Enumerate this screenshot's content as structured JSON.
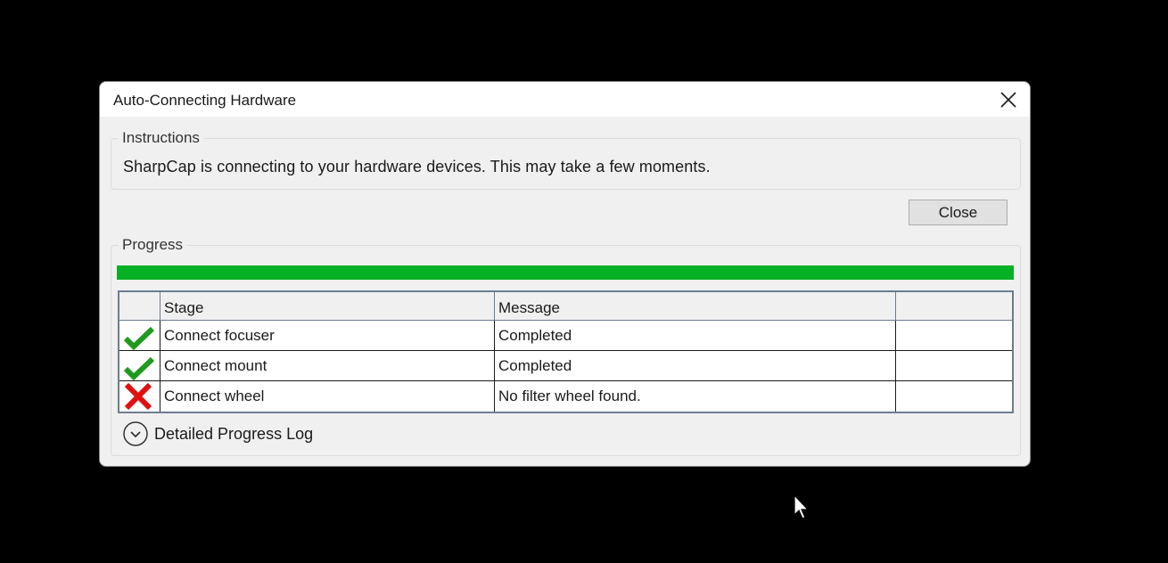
{
  "window": {
    "title": "Auto-Connecting Hardware"
  },
  "instructions": {
    "legend": "Instructions",
    "text": "SharpCap is connecting to your hardware devices. This may take a few moments."
  },
  "buttons": {
    "close_label": "Close"
  },
  "progress": {
    "legend": "Progress",
    "percent": 100,
    "color": "#06b025"
  },
  "table": {
    "columns": [
      "",
      "Stage",
      "Message",
      ""
    ],
    "rows": [
      {
        "status_icon": "check-icon",
        "stage": "Connect focuser",
        "message": "Completed"
      },
      {
        "status_icon": "check-icon",
        "stage": "Connect mount",
        "message": "Completed"
      },
      {
        "status_icon": "cross-icon",
        "stage": "Connect wheel",
        "message": "No filter wheel found."
      }
    ]
  },
  "log": {
    "label": "Detailed Progress Log",
    "icon": "chevron-down-circle-icon"
  }
}
